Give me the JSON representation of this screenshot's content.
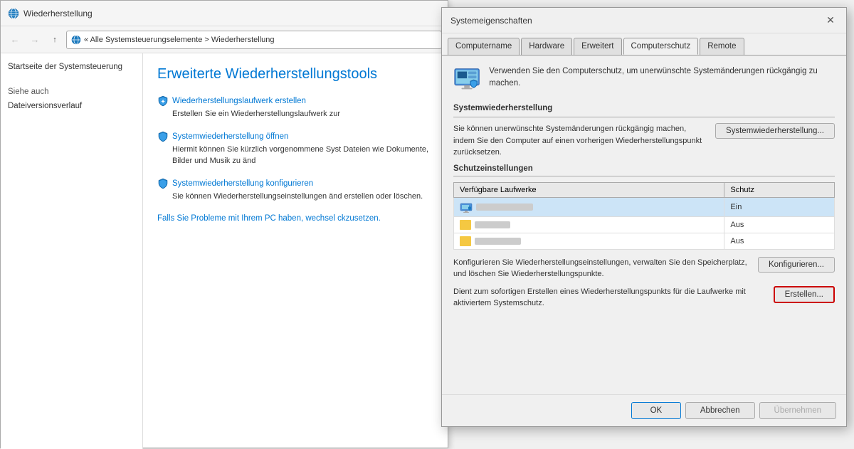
{
  "explorer": {
    "title": "Wiederherstellung",
    "address": "« Alle Systemsteuerungselemente  >  Wiederherstellung",
    "sidebar": {
      "link": "Startseite der Systemsteuerung",
      "see_also": "Siehe auch",
      "file_history": "Dateiversionsverlauf"
    },
    "heading": "Erweiterte Wiederherstellungstools",
    "tools": [
      {
        "link": "Wiederherstellungslaufwerk erstellen",
        "desc": "Erstellen Sie ein Wiederherstellungslaufwerk zur"
      },
      {
        "link": "Systemwiederherstellung öffnen",
        "desc": "Hiermit können Sie kürzlich vorgenommene Syst Dateien wie Dokumente, Bilder und Musik zu änd"
      },
      {
        "link": "Systemwiederherstellung konfigurieren",
        "desc": "Sie können Wiederherstellungseinstellungen änd erstellen oder löschen."
      }
    ],
    "bottom_link": "Falls Sie Probleme mit Ihrem PC haben, wechsel ckzusetzen."
  },
  "dialog": {
    "title": "Systemeigenschaften",
    "tabs": [
      "Computername",
      "Hardware",
      "Erweitert",
      "Computerschutz",
      "Remote"
    ],
    "active_tab": "Computerschutz",
    "info_text": "Verwenden Sie den Computerschutz, um unerwünschte Systemänderungen rückgängig zu machen.",
    "systemwiederherstellung": {
      "header": "Systemwiederherstellung",
      "desc": "Sie können unerwünschte Systemänderungen rückgängig machen, indem Sie den Computer auf einen vorherigen Wiederherstellungspunkt zurücksetzen.",
      "btn": "Systemwiederherstellung..."
    },
    "schutzeinstellungen": {
      "header": "Schutzeinstellungen",
      "table": {
        "columns": [
          "Verfügbare Laufwerke",
          "Schutz"
        ],
        "rows": [
          {
            "name": "drive1",
            "schutz": "Ein",
            "selected": true
          },
          {
            "name": "drive2",
            "schutz": "Aus",
            "selected": false
          },
          {
            "name": "drive3",
            "schutz": "Aus",
            "selected": false
          }
        ]
      }
    },
    "konfigurieren": {
      "desc": "Konfigurieren Sie Wiederherstellungseinstellungen, verwalten Sie den Speicherplatz, und löschen Sie Wiederherstellungspunkte.",
      "btn": "Konfigurieren..."
    },
    "erstellen": {
      "desc": "Dient zum sofortigen Erstellen eines Wiederherstellungspunkts für die Laufwerke mit aktiviertem Systemschutz.",
      "btn": "Erstellen..."
    },
    "footer": {
      "ok": "OK",
      "abbrechen": "Abbrechen",
      "uebernehmen": "Übernehmen"
    }
  }
}
